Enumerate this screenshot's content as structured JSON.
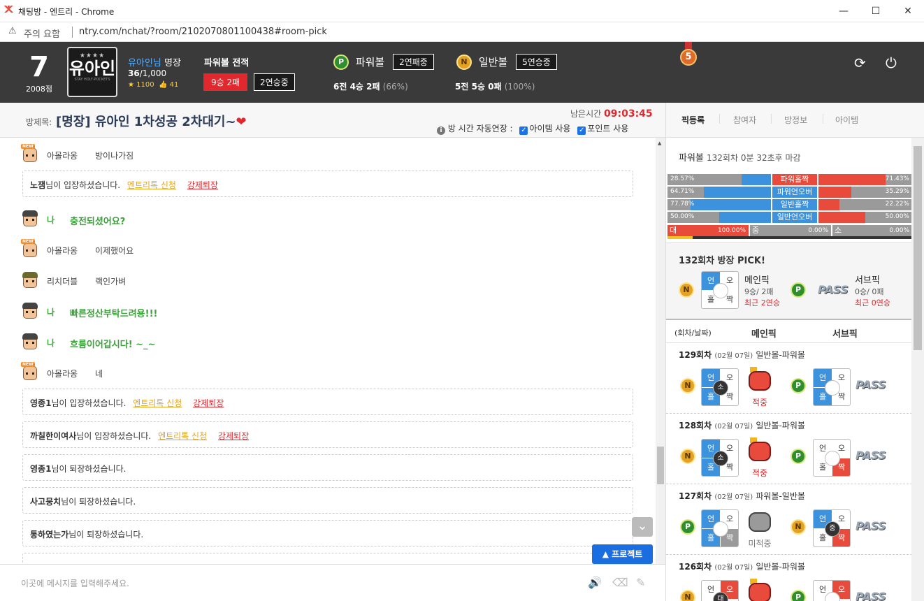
{
  "window": {
    "title": "채팅방 - 엔트리 - Chrome",
    "controls": [
      "minimize",
      "maximize",
      "close"
    ]
  },
  "address": {
    "warning": "주의 요함",
    "url": "ntry.com/nchat/?room/2102070801100438#room-pick"
  },
  "header": {
    "level": "7",
    "points": "2008점",
    "avatar_text": "유아인",
    "avatar_stars": "★★★★",
    "avatar_sub": "STAY HOLY·POCKETS",
    "user_name": "유아인님",
    "user_rank": "명장",
    "progress_cur": "36",
    "progress_max": "/1,000",
    "stars": "1100",
    "likes": "41",
    "record_title": "파워볼 전적",
    "record_winloss": "9승 2패",
    "record_streak": "2연승중",
    "powerball": {
      "coin": "P",
      "name": "파워볼",
      "streak": "2연패중",
      "total": "6전",
      "win": "4승",
      "loss": "2패",
      "pct": "(66%)"
    },
    "normalball": {
      "coin": "N",
      "name": "일반볼",
      "streak": "5연승중",
      "total": "5전",
      "win": "5승",
      "loss": "0패",
      "pct": "(100%)"
    },
    "medal": "5"
  },
  "room": {
    "label": "방제목:",
    "title": "[명장] 유아인 1차성공 2차대기~",
    "heart": "❤",
    "timer_label": "남은시간",
    "timer": "09:03:45",
    "auto_extend": "방 시간 자동연장 :",
    "opt_item": "아이템 사용",
    "opt_point": "포인트 사용"
  },
  "tabs": [
    "픽등록",
    "참여자",
    "방정보",
    "아이템"
  ],
  "chat": {
    "lines": [
      {
        "who": "아몰라옹",
        "msg": "방이나가짐"
      },
      {
        "who": "나",
        "msg": "충전되셨어요?"
      },
      {
        "who": "아몰라옹",
        "msg": "이제했어요"
      },
      {
        "who": "리치더블",
        "msg": "랙인가벼"
      },
      {
        "who": "나",
        "msg": "빠른정산부탁드려용!!!"
      },
      {
        "who": "나",
        "msg": "흐름이어갑시다! ~_~"
      },
      {
        "who": "아몰라옹",
        "msg": "네"
      }
    ],
    "system": [
      {
        "name": "노잼",
        "text": "님이 입장하셨습니다.",
        "link1": "엔트리톡 신청",
        "link2": "강제퇴장"
      },
      {
        "name": "영종1",
        "text": "님이 입장하셨습니다.",
        "link1": "엔트리톡 신청",
        "link2": "강제퇴장"
      },
      {
        "name": "까칠한이여사",
        "text": "님이 입장하셨습니다.",
        "link1": "엔트리톡 신청",
        "link2": "강제퇴장"
      },
      {
        "name": "영종1",
        "text": "님이 퇴장하셨습니다."
      },
      {
        "name": "사고뭉치",
        "text": "님이 퇴장하셨습니다."
      },
      {
        "name": "통하였는가",
        "text": "님이 퇴장하셨습니다."
      }
    ],
    "new_badge": "NEW",
    "project_button": "▲ 프로젝트",
    "input_placeholder": "이곳에 메시지를 입력해주세요."
  },
  "panel": {
    "game": "파워볼",
    "round_info": "132회차 0분 32초후 마감",
    "stats": [
      {
        "left": "28.57%",
        "left_frac": 0.2857,
        "label": "파워홀짝",
        "label_color": "red",
        "right": "71.43%",
        "right_frac": 0.7143
      },
      {
        "left": "64.71%",
        "left_frac": 0.6471,
        "label": "파워언오버",
        "label_color": "blue",
        "right": "35.29%",
        "right_frac": 0.3529
      },
      {
        "left": "77.78%",
        "left_frac": 0.7778,
        "label": "일반홀짝",
        "label_color": "blue",
        "right": "22.22%",
        "right_frac": 0.2222
      },
      {
        "left": "50.00%",
        "left_frac": 0.5,
        "label": "일반언오버",
        "label_color": "blue",
        "right": "50.00%",
        "right_frac": 0.5
      }
    ],
    "size_row": {
      "dae": "대",
      "dae_val": "100.00%",
      "jung": "중",
      "jung_val": "0.00%",
      "so": "소",
      "so_val": "0.00%"
    },
    "pick_title": "132회차 방장 PICK!",
    "main_pick": {
      "title": "메인픽",
      "record": "9승/ 2패",
      "recent": "최근 2연승"
    },
    "sub_pick": {
      "title": "서브픽",
      "record": "0승/ 0패",
      "recent": "최근 0연승"
    },
    "pass": "PASS",
    "cells": {
      "un": "언",
      "o": "오",
      "hol": "홀",
      "jjak": "짝",
      "so": "소",
      "jung": "중",
      "dae": "대"
    },
    "hist_head": {
      "col1": "(회차/날짜)",
      "col2": "메인픽",
      "col3": "서브픽"
    },
    "history": [
      {
        "round": "129회차",
        "date": "(02월 07일)",
        "games": "일반볼-파워볼",
        "result": "적중"
      },
      {
        "round": "128회차",
        "date": "(02월 07일)",
        "games": "일반볼-파워볼",
        "result": "적중"
      },
      {
        "round": "127회차",
        "date": "(02월 07일)",
        "games": "파워볼-일반볼",
        "result": "미적중"
      },
      {
        "round": "126회차",
        "date": "(02월 07일)",
        "games": "일반볼-파워볼",
        "result": ""
      }
    ]
  }
}
